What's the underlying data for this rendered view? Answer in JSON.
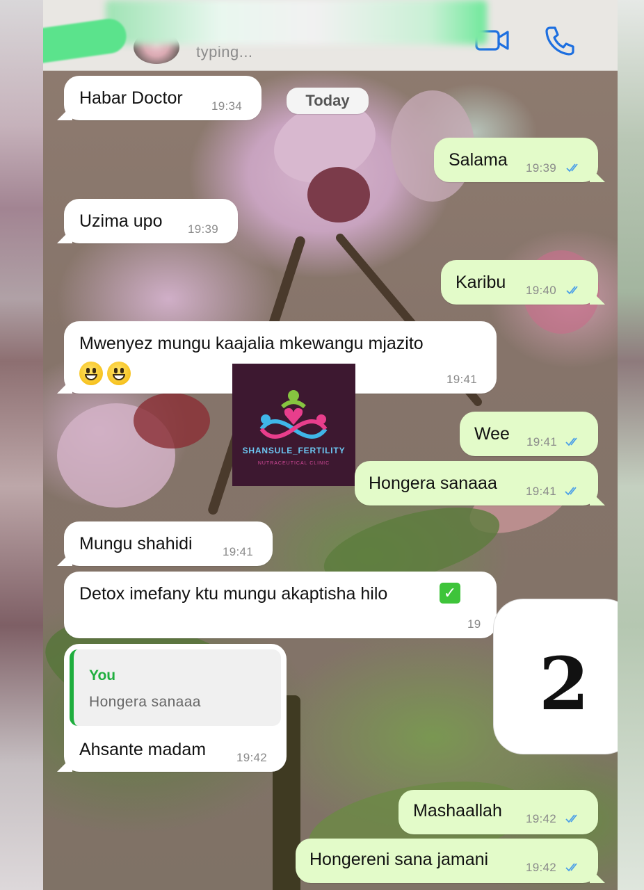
{
  "header": {
    "status": "typing...",
    "video_icon": "video-camera-icon",
    "call_icon": "phone-icon"
  },
  "date_separator": "Today",
  "messages": [
    {
      "dir": "in",
      "text": "Habar Doctor",
      "time": "19:34"
    },
    {
      "dir": "out",
      "text": "Salama",
      "time": "19:39",
      "ticks": "double-check"
    },
    {
      "dir": "in",
      "text": "Uzima upo",
      "time": "19:39"
    },
    {
      "dir": "out",
      "text": "Karibu",
      "time": "19:40",
      "ticks": "double-check"
    },
    {
      "dir": "in",
      "text": "Mwenyez mungu kaajalia mkewangu mjazito",
      "time": "19:41",
      "emojis": [
        "grinning-face",
        "grinning-face"
      ]
    },
    {
      "dir": "out",
      "text": "Wee",
      "time": "19:41",
      "ticks": "double-check"
    },
    {
      "dir": "out",
      "text": "Hongera sanaaa",
      "time": "19:41",
      "ticks": "double-check"
    },
    {
      "dir": "in",
      "text": "Mungu shahidi",
      "time": "19:41"
    },
    {
      "dir": "in",
      "text": "Detox imefany ktu mungu akaptisha hilo",
      "time": "19",
      "emoji": "white-check-mark"
    },
    {
      "dir": "in",
      "text": "Ahsante madam",
      "time": "19:42",
      "quote": {
        "author": "You",
        "text": "Hongera sanaaa"
      }
    },
    {
      "dir": "out",
      "text": "Mashaallah",
      "time": "19:42",
      "ticks": "double-check"
    },
    {
      "dir": "out",
      "text": "Hongereni sana jamani",
      "time": "19:42",
      "ticks": "double-check"
    }
  ],
  "watermark_logo": {
    "name": "SHANSULE_FERTILITY",
    "subtitle": "NUTRACEUTICAL CLINIC"
  },
  "overlay_badge": "2",
  "colors": {
    "incoming_bubble": "#ffffff",
    "outgoing_bubble": "#e3fbc9",
    "read_ticks": "#4a9ee8",
    "header_icons": "#1d6fe0",
    "quote_accent": "#1fae3e"
  }
}
